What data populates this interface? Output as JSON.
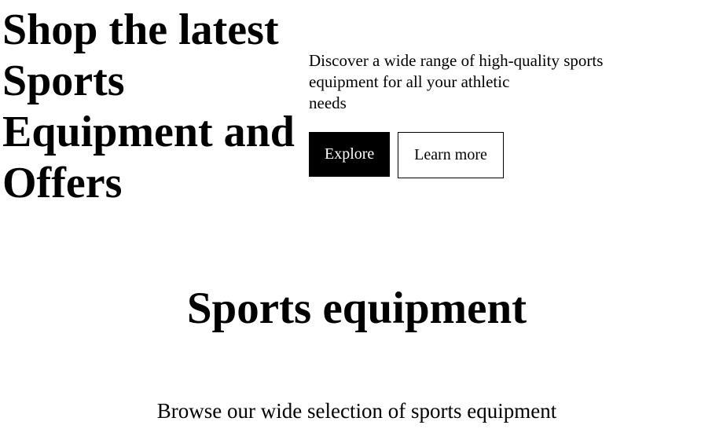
{
  "hero": {
    "title": "Shop the latest Sports Equipment and Offers",
    "description_lines": [
      "Discover a wide range of high-quality sports",
      "equipment for all your athletic",
      "needs"
    ],
    "explore_label": "Explore",
    "learn_more_label": "Learn more"
  },
  "section": {
    "title": "Sports equipment",
    "subtitle": "Browse our wide selection of sports equipment"
  }
}
